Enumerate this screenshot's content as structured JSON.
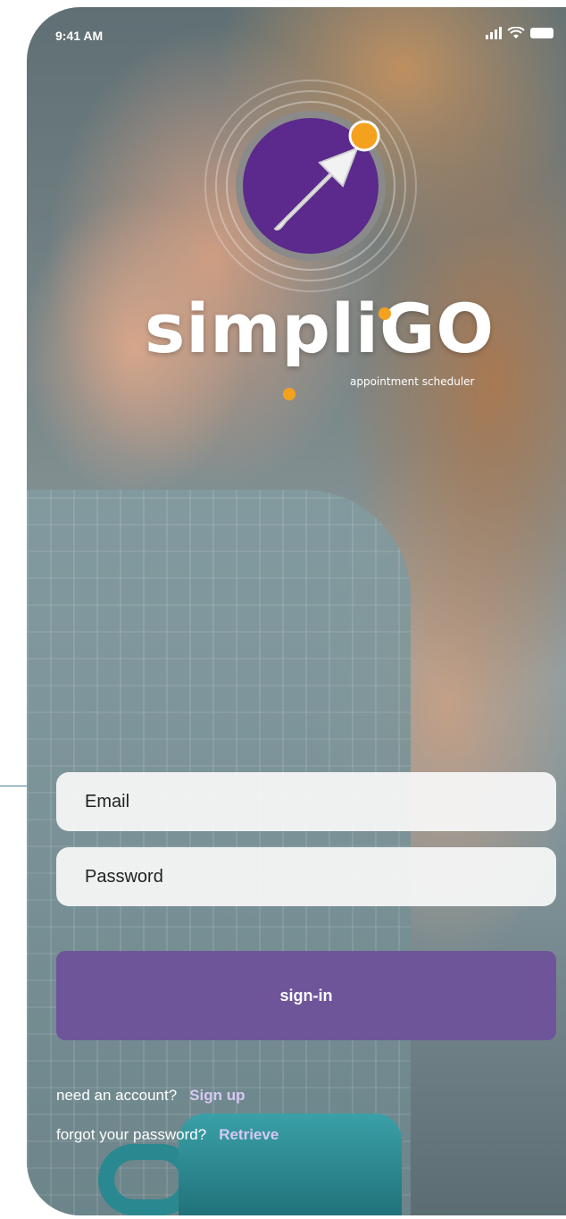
{
  "status_bar": {
    "time": "9:41 AM",
    "icons": [
      "cellular-signal-icon",
      "wifi-icon",
      "battery-icon"
    ]
  },
  "brand": {
    "name": "simpliGO",
    "tagline": "appointment scheduler",
    "colors": {
      "logo_purple": "#5b2a8c",
      "accent_orange": "#f4a11e"
    }
  },
  "login_form": {
    "email_placeholder": "Email",
    "password_placeholder": "Password",
    "submit_label": "sign-in",
    "submit_color": "#6e559a"
  },
  "footer": {
    "signup_prompt": "need an account?",
    "signup_link": "Sign up",
    "retrieve_prompt": "forgot your password?",
    "retrieve_link": "Retrieve",
    "link_color": "#d7c8f2"
  }
}
